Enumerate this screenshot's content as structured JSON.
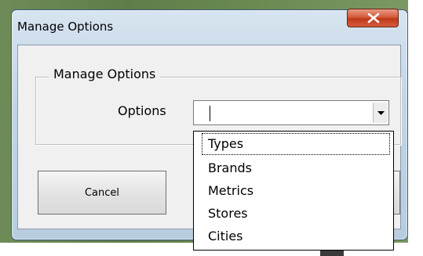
{
  "window": {
    "title": "Manage Options"
  },
  "group": {
    "label": "Manage Options"
  },
  "options": {
    "label": "Options",
    "value": "",
    "items": [
      "Types",
      "Brands",
      "Metrics",
      "Stores",
      "Cities"
    ],
    "focused_index": 0
  },
  "buttons": {
    "cancel": "Cancel",
    "ok": ""
  },
  "icons": {
    "close": "close-icon",
    "dropdown": "chevron-down-icon"
  },
  "colors": {
    "close_button": "#c8452a",
    "titlebar": "#c6d8e8",
    "background": "#6a8a52"
  }
}
